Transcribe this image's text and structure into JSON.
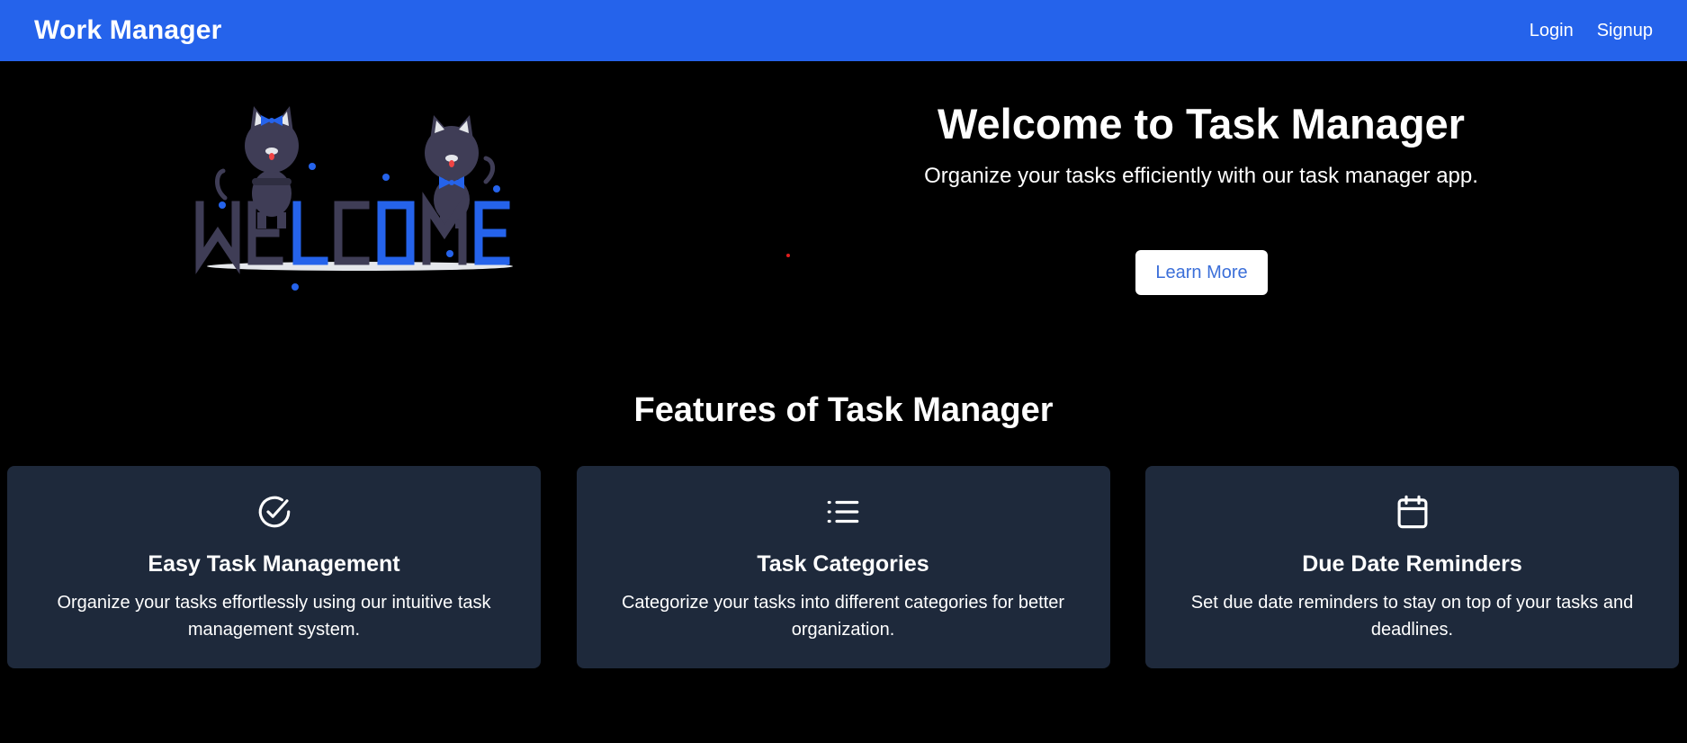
{
  "navbar": {
    "brand": "Work Manager",
    "links": [
      {
        "label": "Login"
      },
      {
        "label": "Signup"
      }
    ],
    "background": "#2563eb"
  },
  "hero": {
    "title": "Welcome to Task Manager",
    "subtitle": "Organize your tasks efficiently with our task manager app.",
    "button_label": "Learn More",
    "illustration": {
      "icon": "welcome-cats-illustration",
      "text": "WELCOME"
    }
  },
  "features": {
    "title": "Features of Task Manager",
    "cards": [
      {
        "icon": "check-circle-icon",
        "title": "Easy Task Management",
        "description": "Organize your tasks effortlessly using our intuitive task management system."
      },
      {
        "icon": "list-icon",
        "title": "Task Categories",
        "description": "Categorize your tasks into different categories for better organization."
      },
      {
        "icon": "calendar-icon",
        "title": "Due Date Reminders",
        "description": "Set due date reminders to stay on top of your tasks and deadlines."
      }
    ],
    "card_background": "#1e293b"
  },
  "colors": {
    "accent": "#2563eb",
    "page_background": "#000000",
    "button_text": "#3b6fd9"
  }
}
